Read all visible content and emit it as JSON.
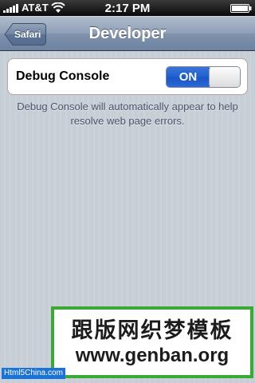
{
  "status_bar": {
    "carrier": "AT&T",
    "time": "2:17 PM",
    "signal_icon": "signal-bars-icon",
    "wifi_icon": "wifi-icon",
    "battery_icon": "battery-icon"
  },
  "nav": {
    "back_label": "Safari",
    "title": "Developer"
  },
  "settings": {
    "debug_console_label": "Debug Console",
    "debug_console_state": "ON",
    "debug_console_on": true,
    "footer": "Debug Console will automatically appear to help resolve web page errors."
  },
  "watermark": {
    "chinese": "跟版网织梦模板",
    "url": "www.genban.org",
    "stamp": "Html5China.com"
  },
  "colors": {
    "nav_bar": "#7f92ad",
    "switch_on": "#1f60d0",
    "watermark_border": "#3aaa35",
    "stamp_bg": "#1a73d9"
  }
}
